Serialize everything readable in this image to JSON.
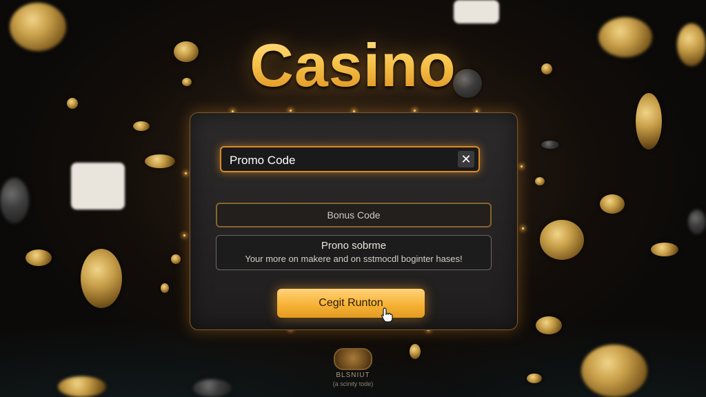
{
  "title": "Casino",
  "promo_field": {
    "value": "Promo Code",
    "clear_icon": "close-icon"
  },
  "bonus_field": {
    "placeholder": "Bonus Code"
  },
  "info": {
    "title": "Prono sobrme",
    "description": "Your more on makere and on sstmocdl boginter hases!"
  },
  "cta_button": {
    "label": "Cegit Runton"
  },
  "footer": {
    "logo_text": "BLSNIUT",
    "logo_subtext": "(a scinity tode)"
  },
  "colors": {
    "accent": "#f7b336",
    "panel_border": "#d98b2a",
    "background": "#120d09"
  }
}
